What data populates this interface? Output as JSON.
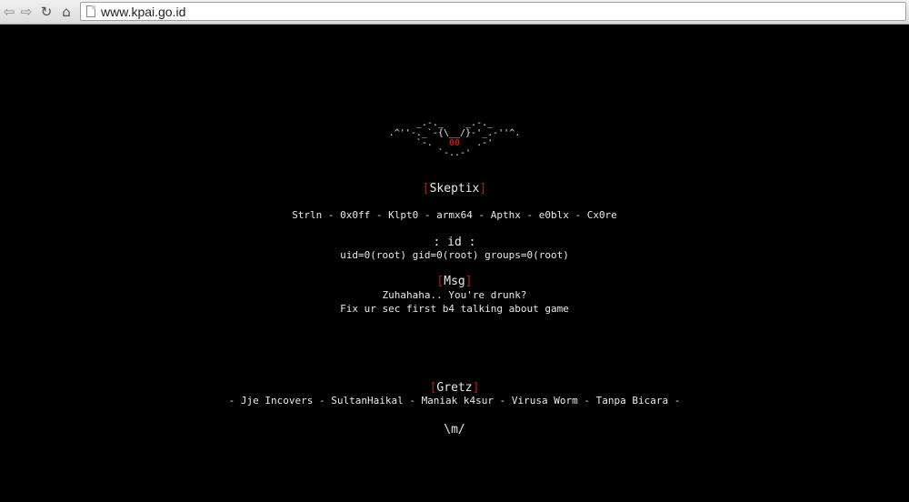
{
  "browser": {
    "url": "www.kpai.go.id",
    "back_icon": "arrow-left",
    "forward_icon": "arrow-right",
    "reload_icon": "reload",
    "home_icon": "home"
  },
  "ascii_art": {
    "line1": "_.-._    _.-._",
    "line2a": ".^''-._`-{\\__/}-'_.-''^.",
    "line3a": "`-.",
    "eyes": "00",
    "line3b": ".-'",
    "line4": "`-..-'"
  },
  "title_section": {
    "bracket_open": "[",
    "title": "Skeptix",
    "bracket_close": "]"
  },
  "members": "Strln - 0x0ff - Klpt0 - armx64 - Apthx - e0blx - Cx0re",
  "id_section": {
    "label": ": id :",
    "value": "uid=0(root) gid=0(root) groups=0(root)"
  },
  "msg_section": {
    "bracket_open": "[",
    "title": "Msg",
    "bracket_close": "]",
    "line1": "Zuhahaha.. You're drunk?",
    "line2": "Fix ur sec first b4 talking about game"
  },
  "gretz_section": {
    "bracket_open": "[",
    "title": "Gretz",
    "bracket_close": "]",
    "names": "- Jje Incovers - SultanHaikal - Maniak k4sur - Virusa Worm - Tanpa Bicara -"
  },
  "signoff": "\\m/",
  "colors": {
    "background": "#000000",
    "text": "#e8e8e8",
    "accent": "#c01818"
  }
}
